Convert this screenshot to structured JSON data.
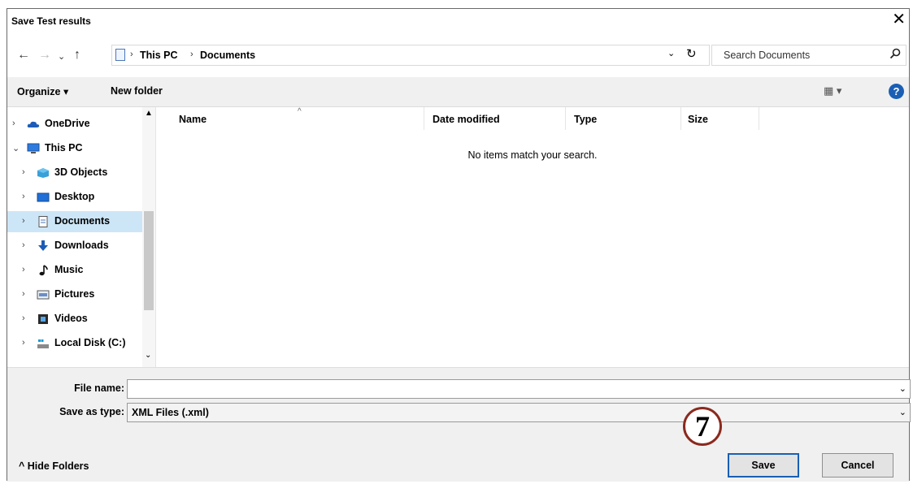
{
  "window": {
    "title": "Save Test results",
    "close_glyph": "✕"
  },
  "address": {
    "back_glyph": "←",
    "forward_glyph": "→",
    "recent_glyph": "⌄",
    "up_glyph": "↑",
    "crumbs": [
      "This PC",
      "Documents"
    ],
    "crumb_sep": "›",
    "dropdown_glyph": "⌄",
    "refresh_glyph": "↻"
  },
  "search": {
    "placeholder": "Search Documents"
  },
  "toolbar": {
    "organize_label": "Organize ▾",
    "new_folder_label": "New folder",
    "view_glyph": "▦ ▾",
    "help_glyph": "?"
  },
  "nav": {
    "items": [
      {
        "label": "OneDrive",
        "icon": "cloud-icon",
        "chevron": "›"
      },
      {
        "label": "This PC",
        "icon": "computer-icon",
        "chevron": "⌄"
      },
      {
        "label": "3D Objects",
        "icon": "cube-icon",
        "chevron": "›"
      },
      {
        "label": "Desktop",
        "icon": "desktop-icon",
        "chevron": "›"
      },
      {
        "label": "Documents",
        "icon": "document-icon",
        "chevron": "›",
        "selected": true
      },
      {
        "label": "Downloads",
        "icon": "download-icon",
        "chevron": "›"
      },
      {
        "label": "Music",
        "icon": "music-icon",
        "chevron": "›"
      },
      {
        "label": "Pictures",
        "icon": "pictures-icon",
        "chevron": "›"
      },
      {
        "label": "Videos",
        "icon": "video-icon",
        "chevron": "›"
      },
      {
        "label": "Local Disk (C:)",
        "icon": "disk-icon",
        "chevron": "›"
      }
    ],
    "scroll_up_glyph": "▲",
    "scroll_down_glyph": "⌄"
  },
  "filelist": {
    "columns": [
      "Name",
      "Date modified",
      "Type",
      "Size"
    ],
    "sort_glyph": "^",
    "empty_message": "No items match your search."
  },
  "form": {
    "file_name_label": "File name:",
    "file_name_value": "",
    "save_type_label": "Save as type:",
    "save_type_value": "XML Files (.xml)",
    "dropdown_glyph": "⌄"
  },
  "footer": {
    "hide_folders_label": "^  Hide Folders",
    "save_label": "Save",
    "cancel_label": "Cancel"
  },
  "callout": {
    "step_number": "7"
  },
  "colors": {
    "accent": "#1a5fb4",
    "selection": "#cde6f7",
    "callout_ring": "#8b2a1e"
  }
}
